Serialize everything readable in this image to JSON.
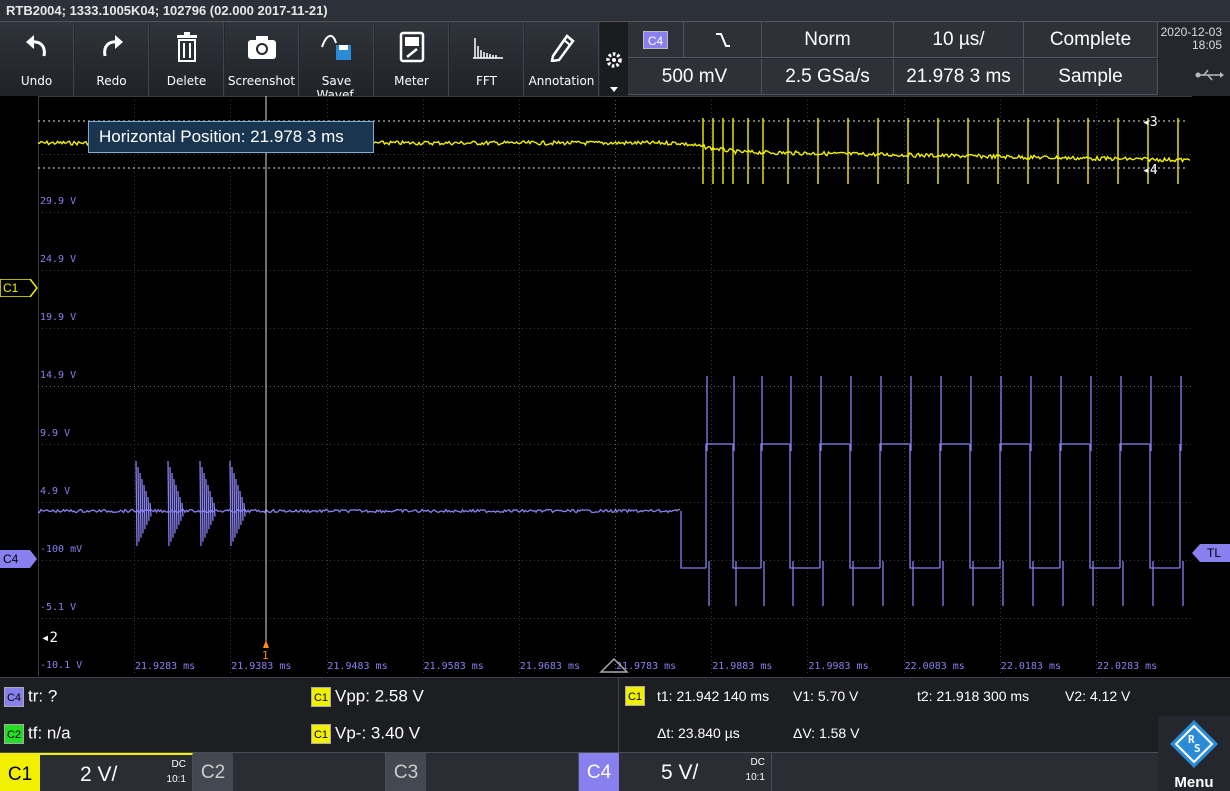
{
  "title_bar": {
    "text": "RTB2004; 1333.1005K04; 102796 (02.000 2017-11-21)"
  },
  "toolbar": {
    "buttons": [
      {
        "label": "Undo",
        "icon": "undo-icon"
      },
      {
        "label": "Redo",
        "icon": "redo-icon"
      },
      {
        "label": "Delete",
        "icon": "trash-icon"
      },
      {
        "label": "Screenshot",
        "icon": "camera-icon"
      },
      {
        "label": "Save Wavef.",
        "icon": "save-waveform-icon"
      },
      {
        "label": "Meter",
        "icon": "meter-icon"
      },
      {
        "label": "FFT",
        "icon": "fft-icon"
      },
      {
        "label": "Annotation",
        "icon": "pencil-icon"
      }
    ]
  },
  "status": {
    "trigger_source": "C4",
    "trigger_slope_icon": "falling-edge-icon",
    "trigger_mode": "Norm",
    "time_scale": "10 µs/",
    "acq_state": "Complete",
    "trigger_level": "500 mV",
    "sample_rate": "2.5 GSa/s",
    "horizontal_position": "21.978 3 ms",
    "acq_mode": "Sample",
    "date": "2020-12-03",
    "time": "18:05",
    "usb_icon": "usb-icon"
  },
  "tooltip": {
    "text": "Horizontal Position: 21.978 3 ms"
  },
  "grid": {
    "y_labels": [
      "29.9 V",
      "24.9 V",
      "19.9 V",
      "14.9 V",
      "9.9 V",
      "4.9 V",
      "-100 mV",
      "-5.1 V",
      "-10.1 V"
    ],
    "x_labels": [
      "21.9283 ms",
      "21.9383 ms",
      "21.9483 ms",
      "21.9583 ms",
      "21.9683 ms",
      "21.9783 ms",
      "21.9883 ms",
      "21.9983 ms",
      "22.0083 ms",
      "22.0183 ms",
      "22.0283 ms"
    ]
  },
  "markers": {
    "c1_label": "C1",
    "c4_label": "C4",
    "tl_label": "TL",
    "cursor3": "3",
    "cursor4": "4",
    "cursor2": "2",
    "cursor1": "1"
  },
  "measurements": {
    "m1": {
      "channel": "C4",
      "text": "tr: ?"
    },
    "m2": {
      "channel": "C2",
      "text": "tf: n/a"
    },
    "m3": {
      "channel": "C1",
      "text": "Vpp: 2.58 V"
    },
    "m4": {
      "channel": "C1",
      "text": "Vp-: 3.40 V"
    },
    "cursor_channel": "C1",
    "t1": "t1: 21.942 140 ms",
    "v1": "V1: 5.70 V",
    "t2": "t2: 21.918 300 ms",
    "v2": "V2: 4.12 V",
    "dt": "Δt: 23.840 µs",
    "dv": "ΔV: 1.58 V"
  },
  "channels": {
    "c1": {
      "name": "C1",
      "scale": "2 V/",
      "coupling": "DC",
      "probe": "10:1"
    },
    "c2": {
      "name": "C2"
    },
    "c3": {
      "name": "C3"
    },
    "c4": {
      "name": "C4",
      "scale": "5 V/",
      "coupling": "DC",
      "probe": "10:1"
    }
  },
  "menu": {
    "label": "Menu",
    "logo": "rohde-schwarz-logo"
  },
  "colors": {
    "c1": "#f0f000",
    "c2": "#22dd22",
    "c3": "#9a9a9a",
    "c4": "#8880ee",
    "accent": "#2b8bd6"
  }
}
